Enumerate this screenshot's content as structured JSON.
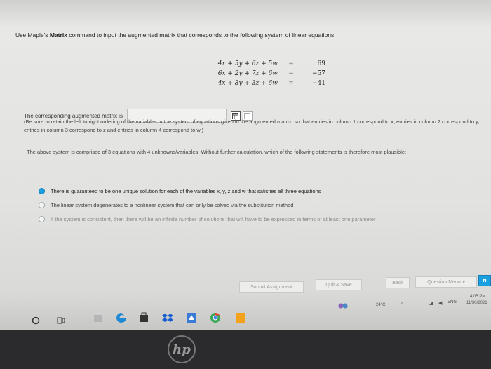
{
  "question": {
    "prefix": "Use Maple's ",
    "bold": "Matrix",
    "suffix": " command to input the augmented matrix that corresponds to the following system of linear equations"
  },
  "system": [
    {
      "lhs": "4x + 5y + 6z + 5w",
      "rel": "=",
      "rhs": "69"
    },
    {
      "lhs": "6x + 2y + 7z + 6w",
      "rel": "=",
      "rhs": "−57"
    },
    {
      "lhs": "4x + 8y + 3z + 6w",
      "rel": "=",
      "rhs": "−41"
    }
  ],
  "answer": {
    "label": "The corresponding augmented matrix is",
    "value": "",
    "icons": [
      "matrix-template-icon",
      "matrix-help-icon"
    ]
  },
  "note": "(Be sure to retain the left to right ordering of the variables in the system of equations given in the augmented matrix, so that entries in column 1 correspond to x, entries in column 2 correspond to y, entries in column 3 correspond to z and entries in column 4 correspond to w.)",
  "statement": "The above system is comprised of 3 equations with 4 unknowns/variables. Without further calculation, which of the following statements is therefore most plausible:",
  "options": [
    {
      "text": "There is guaranteed to be one unique solution for each of the variables x, y, z and w that satisfies all three equations",
      "selected": true
    },
    {
      "text": "The linear system degenerates to a nonlinear system that can only be solved via the substitution method",
      "selected": false
    },
    {
      "text": "If the system is consistent, then there will be an infinite number of solutions that will have to be expressed in terms of at least one parameter",
      "selected": false
    }
  ],
  "buttons": {
    "submit": "Submit Assignment",
    "quit": "Quit & Save",
    "back": "Back",
    "menu": "Question Menu",
    "next": "N"
  },
  "taskbar": {
    "weather": "24°C",
    "lang": "ENG",
    "time": "4:05 PM",
    "date": "11/30/2021"
  },
  "brand": "hp",
  "colors": {
    "accent": "#1a9fe0"
  }
}
